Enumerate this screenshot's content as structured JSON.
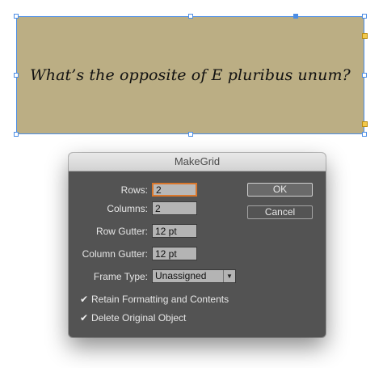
{
  "canvas": {
    "frame_text": "What’s the opposite of E pluribus unum?",
    "frame_color": "#bbae84",
    "selection_color": "#4c8ee6"
  },
  "dialog": {
    "title": "MakeGrid",
    "rows_label": "Rows:",
    "rows_value": "2",
    "columns_label": "Columns:",
    "columns_value": "2",
    "row_gutter_label": "Row Gutter:",
    "row_gutter_value": "12 pt",
    "column_gutter_label": "Column Gutter:",
    "column_gutter_value": "12 pt",
    "frame_type_label": "Frame Type:",
    "frame_type_value": "Unassigned",
    "retain_formatting_label": "Retain Formatting and Contents",
    "retain_formatting_checked": true,
    "delete_original_label": "Delete Original Object",
    "delete_original_checked": true,
    "ok_label": "OK",
    "cancel_label": "Cancel",
    "checkmark_glyph": "✔"
  }
}
